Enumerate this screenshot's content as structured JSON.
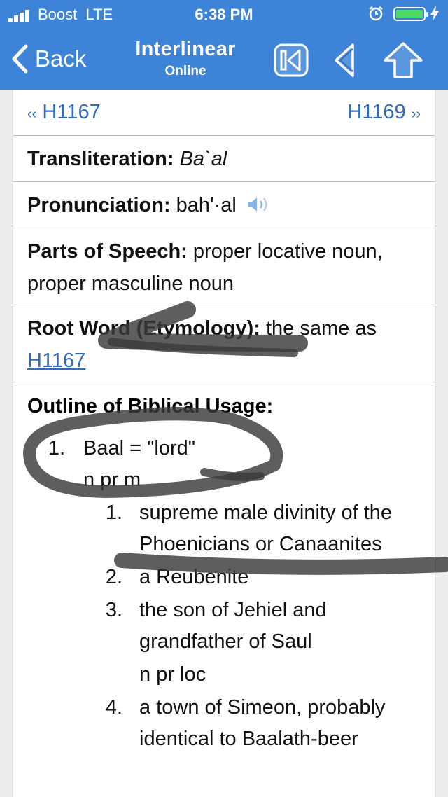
{
  "status_bar": {
    "carrier": "Boost",
    "network": "LTE",
    "time": "6:38 PM"
  },
  "nav": {
    "back_label": "Back",
    "title": "Interlinear",
    "subtitle": "Online",
    "icons": [
      "first-page-icon",
      "previous-icon",
      "up-icon"
    ]
  },
  "entry": {
    "prev_link": "H1167",
    "next_link": "H1169",
    "transliteration_label": "Transliteration:",
    "transliteration_value": "Ba`al",
    "pronunciation_label": "Pronunciation:",
    "pronunciation_value": "bah'·al",
    "parts_of_speech_label": "Parts of Speech:",
    "parts_of_speech_value": "proper locative noun, proper masculine noun",
    "root_word_label": "Root Word (Etymology):",
    "root_word_value": "the same as",
    "root_word_link": "H1167",
    "outline_title": "Outline of Biblical Usage:",
    "outline": [
      {
        "number": "1.",
        "text": "Baal = \"lord\"",
        "tag": "n pr m",
        "subitems": [
          {
            "number": "1.",
            "text": "supreme male divinity of the Phoenicians or Canaanites"
          },
          {
            "number": "2.",
            "text": "a Reubenite"
          },
          {
            "number": "3.",
            "text": "the son of Jehiel and grandfather of Saul"
          },
          {
            "tag": "n pr loc"
          },
          {
            "number": "4.",
            "text": "a town of Simeon, probably identical to Baalath-beer"
          }
        ]
      }
    ]
  },
  "colors": {
    "nav_blue": "#3d84d8",
    "link_blue": "#2f6dc4",
    "battery_green": "#4cd964",
    "marker": "#3a3a3a"
  }
}
